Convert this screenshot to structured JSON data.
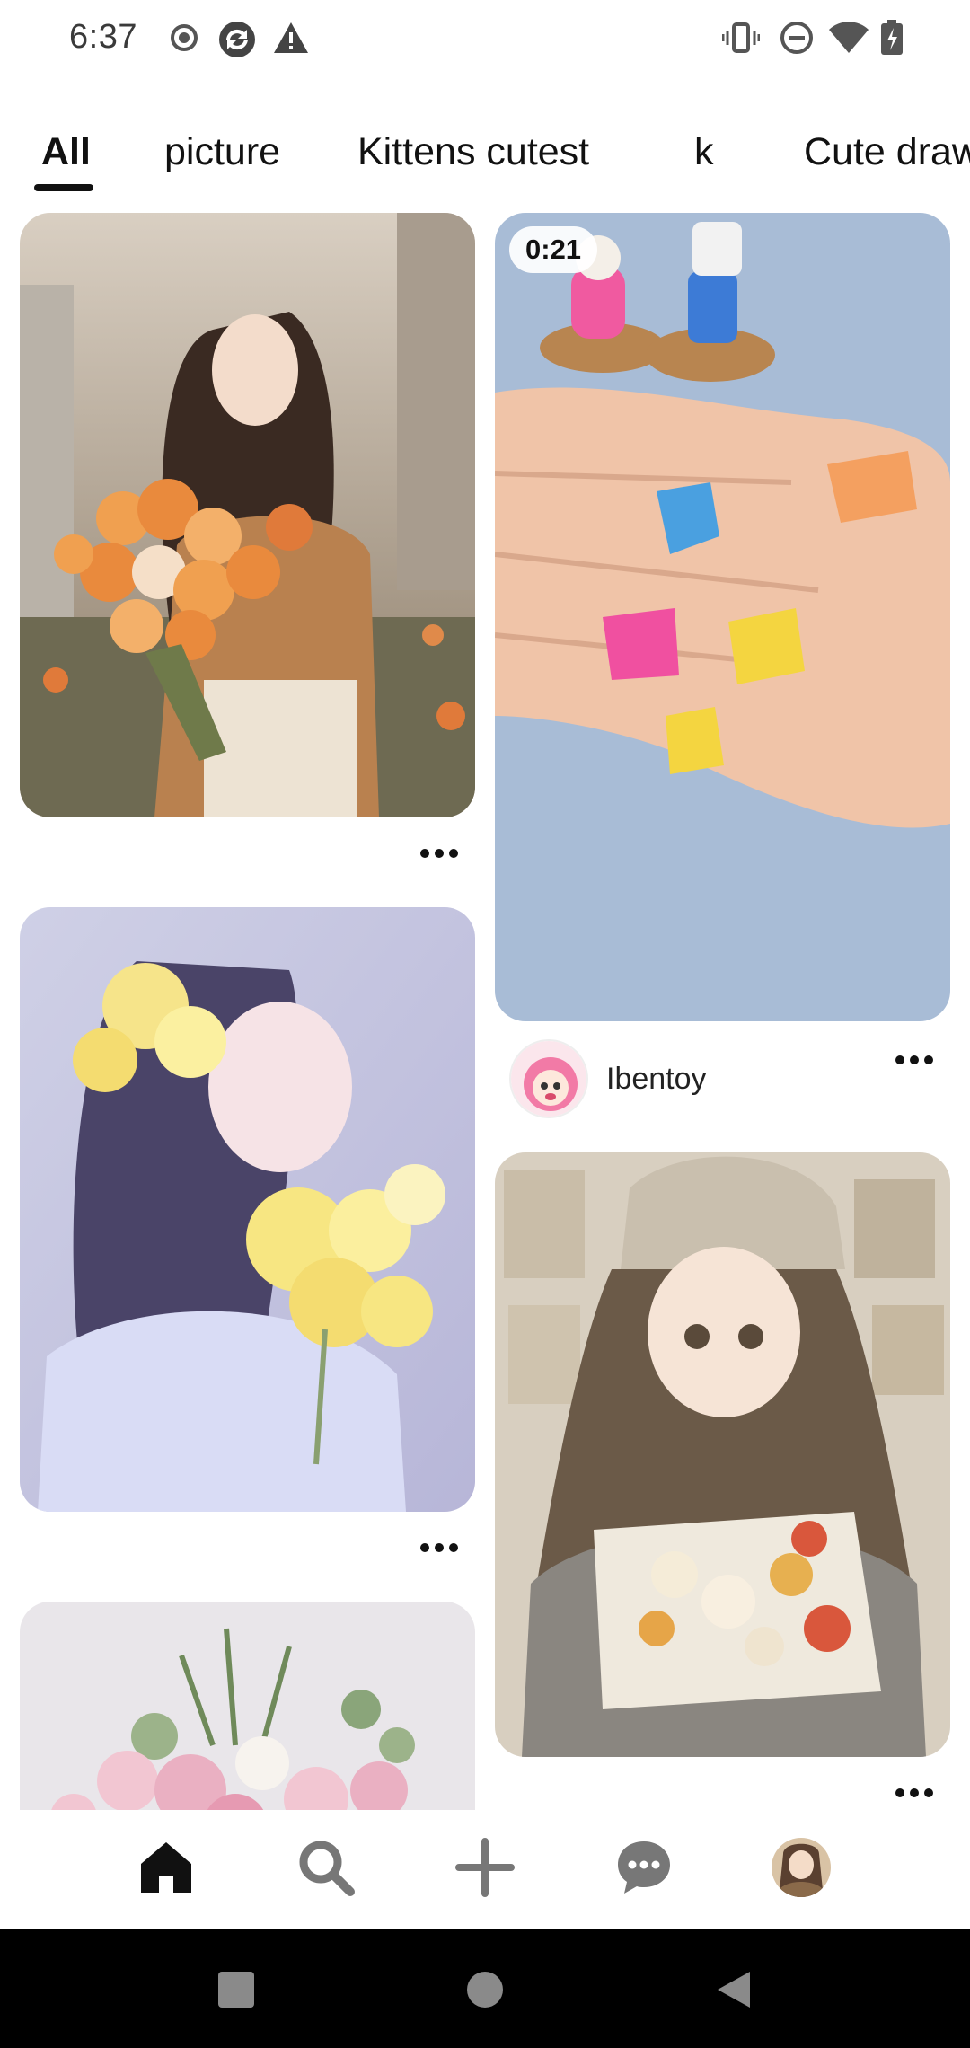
{
  "status_bar": {
    "time": "6:37",
    "left_icons": [
      "record-icon",
      "sync-icon",
      "warning-icon"
    ],
    "right_icons": [
      "vibrate-icon",
      "dnd-icon",
      "wifi-icon",
      "battery-icon"
    ]
  },
  "tabs": [
    {
      "label": "All",
      "selected": true
    },
    {
      "label": "picture",
      "selected": false
    },
    {
      "label": "Kittens cutest",
      "selected": false
    },
    {
      "label": "k",
      "selected": false
    },
    {
      "label": "Cute draw",
      "selected": false
    }
  ],
  "feed": {
    "video_pin": {
      "duration": "0:21",
      "creator_name": "Ibentoy"
    }
  },
  "bottom_nav": {
    "items": [
      "home-icon",
      "search-icon",
      "create-icon",
      "messages-icon",
      "profile-avatar"
    ],
    "active": "home-icon"
  },
  "colors": {
    "text": "#111111",
    "nav_background": "#000000",
    "nav_icons": "#777777"
  }
}
